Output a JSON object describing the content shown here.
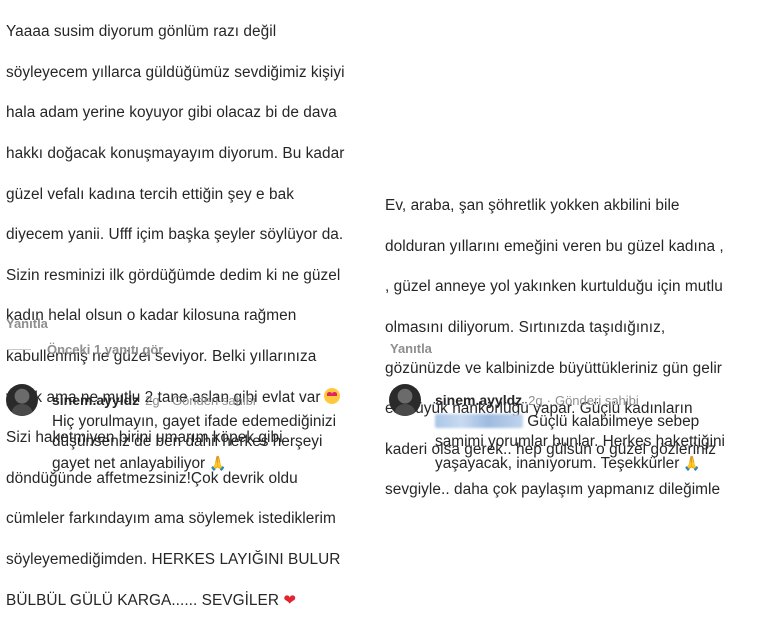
{
  "left": {
    "comment_lines": [
      "Yaaaa susim diyorum gönlüm razı değil",
      "söyleyecem yıllarca güldüğümüz sevdiğimiz kişiyi",
      "hala adam yerine koyuyor gibi olacaz bi de dava",
      "hakkı doğacak konuşmayayım diyorum. Bu kadar",
      "güzel vefalı kadına tercih ettiğin şey e bak",
      "diyecem yanii. Ufff içim başka şeyler söylüyor da.",
      "Sizin resminizi ilk gördüğümde dedim ki ne güzel",
      "kadın helal olsun o kadar kilosuna rağmen",
      "kabullenmiş ne güzel seviyor. Belki yıllarınıza",
      "yazık ama ne mutlu 2 tane aslan gibi evlat var",
      "Sizi haketmiyen birini umarım köpek gibi",
      "döndüğünde affetmezsiniz!Çok devrik oldu",
      "cümleler farkındayım ama söylemek istediklerim",
      "söyleyemediğimden. HERKES LAYIĞINI BULUR",
      "BÜLBÜL GÜLÜ KARGA...... SEVGİLER"
    ],
    "reply_label": "Yanıtla",
    "view_replies": "Önceki 1 yanıtı gör",
    "reply": {
      "username": "sinem.ayyldz",
      "time": "2g",
      "separator": "·",
      "badge": "Gönderi sahibi",
      "text": "Hiç yorulmayın, gayet ifade edemediğinizi\ndüşünseniz de ben dahil herkes herşeyi\ngayet net anlayabiliyor"
    },
    "emoji_heart": "❤",
    "emoji_pray": "🙏"
  },
  "right": {
    "comment_lines": [
      "Ev, araba, şan şöhretlik yokken akbilini  bile",
      "dolduran yıllarını emeğini veren  bu güzel kadına ,",
      ", güzel anneye yol yakınken kurtulduğu için mutlu",
      "olmasını diliyorum. Sırtınızda taşıdığınız,",
      "gözünüzde ve kalbinizde büyüttükleriniz gün gelir",
      "en büyük nankörlüğü yapar. Güçlü kadınların",
      "kaderi olsa gerek.. hep gülsün o güzel gözleriniz",
      "sevgiyle.. daha çok paylaşım yapmanız dileğimle"
    ],
    "reply_label": "Yanıtla",
    "reply": {
      "username": "sinem.ayyldz",
      "time": "2g",
      "separator": "·",
      "badge": "Gönderi sahibi",
      "text_after_mention": " Güçlü kalabilmeye sebep",
      "text_rest": "samimi yorumlar bunlar. Herkes hakettiğini\nyaşayacak, inanıyorum. Teşekkürler"
    },
    "emoji_pray": "🙏"
  }
}
